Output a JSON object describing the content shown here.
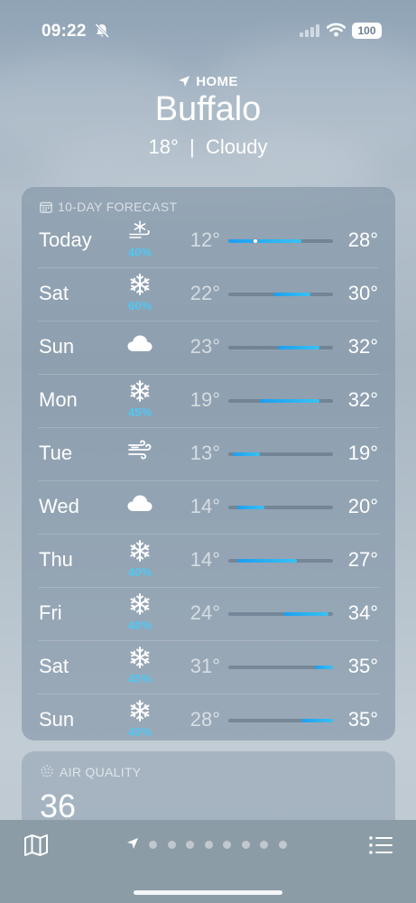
{
  "status": {
    "time": "09:22",
    "battery": "100"
  },
  "header": {
    "location_label": "HOME",
    "city": "Buffalo",
    "temp": "18°",
    "separator": "|",
    "condition": "Cloudy"
  },
  "forecast": {
    "title": "10-DAY FORECAST",
    "scale": {
      "min": 12,
      "max": 35
    },
    "days": [
      {
        "day": "Today",
        "icon": "snow-wind-icon",
        "precip": "40%",
        "low": "12°",
        "high": "28°",
        "lo": 12,
        "hi": 28,
        "current": 18
      },
      {
        "day": "Sat",
        "icon": "snowflake-icon",
        "precip": "60%",
        "low": "22°",
        "high": "30°",
        "lo": 22,
        "hi": 30
      },
      {
        "day": "Sun",
        "icon": "cloud-icon",
        "precip": "",
        "low": "23°",
        "high": "32°",
        "lo": 23,
        "hi": 32
      },
      {
        "day": "Mon",
        "icon": "snowflake-icon",
        "precip": "45%",
        "low": "19°",
        "high": "32°",
        "lo": 19,
        "hi": 32
      },
      {
        "day": "Tue",
        "icon": "wind-icon",
        "precip": "",
        "low": "13°",
        "high": "19°",
        "lo": 13,
        "hi": 19
      },
      {
        "day": "Wed",
        "icon": "cloud-icon",
        "precip": "",
        "low": "14°",
        "high": "20°",
        "lo": 14,
        "hi": 20
      },
      {
        "day": "Thu",
        "icon": "snowflake-icon",
        "precip": "40%",
        "low": "14°",
        "high": "27°",
        "lo": 14,
        "hi": 27
      },
      {
        "day": "Fri",
        "icon": "snowflake-icon",
        "precip": "40%",
        "low": "24°",
        "high": "34°",
        "lo": 24,
        "hi": 34
      },
      {
        "day": "Sat",
        "icon": "snowflake-icon",
        "precip": "45%",
        "low": "31°",
        "high": "35°",
        "lo": 31,
        "hi": 35
      },
      {
        "day": "Sun",
        "icon": "snowflake-icon",
        "precip": "40%",
        "low": "28°",
        "high": "35°",
        "lo": 28,
        "hi": 35
      }
    ]
  },
  "air_quality": {
    "title": "AIR QUALITY",
    "value": "36"
  },
  "colors": {
    "precip": "#4fc8f5",
    "bar_start": "#1e9ef0",
    "bar_end": "#38c2f2"
  },
  "bottom_bar": {
    "page_count": 8
  }
}
